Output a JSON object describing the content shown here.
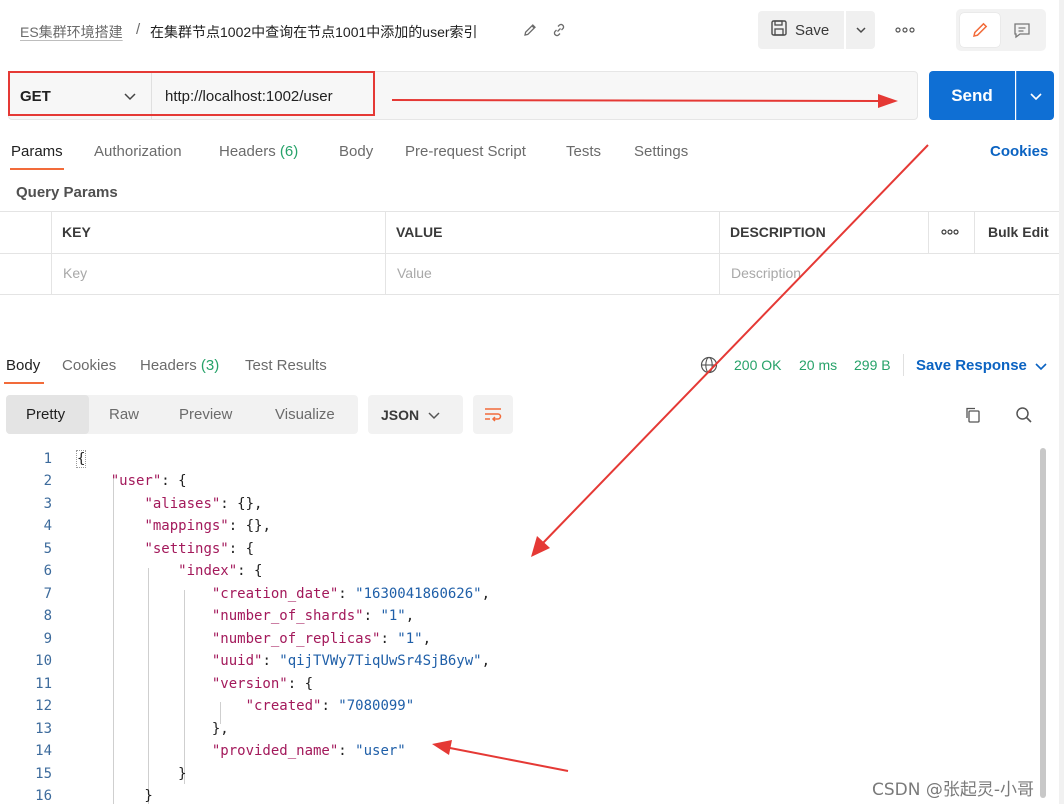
{
  "header": {
    "breadcrumb_parent": "ES集群环境搭建",
    "breadcrumb_separator": "/",
    "request_name": "在集群节点1002中查询在节点1001中添加的user索引",
    "save_label": "Save"
  },
  "request": {
    "method": "GET",
    "url": "http://localhost:1002/user",
    "send_label": "Send"
  },
  "request_tabs": {
    "params": "Params",
    "authorization": "Authorization",
    "headers": "Headers",
    "headers_count": "(6)",
    "body": "Body",
    "pre_request": "Pre-request Script",
    "tests": "Tests",
    "settings": "Settings",
    "cookies": "Cookies"
  },
  "query_params": {
    "label": "Query Params",
    "columns": {
      "key": "KEY",
      "value": "VALUE",
      "description": "DESCRIPTION",
      "bulk_edit": "Bulk Edit"
    },
    "placeholders": {
      "key": "Key",
      "value": "Value",
      "description": "Description"
    }
  },
  "response_tabs": {
    "body": "Body",
    "cookies": "Cookies",
    "headers": "Headers",
    "headers_count": "(3)",
    "test_results": "Test Results"
  },
  "response_status": {
    "status": "200 OK",
    "time": "20 ms",
    "size": "299 B",
    "save_response": "Save Response"
  },
  "view_modes": {
    "pretty": "Pretty",
    "raw": "Raw",
    "preview": "Preview",
    "visualize": "Visualize",
    "format": "JSON"
  },
  "code_lines": [
    "1",
    "2",
    "3",
    "4",
    "5",
    "6",
    "7",
    "8",
    "9",
    "10",
    "11",
    "12",
    "13",
    "14",
    "15",
    "16"
  ],
  "json": {
    "root_key": "\"user\"",
    "aliases_key": "\"aliases\"",
    "mappings_key": "\"mappings\"",
    "settings_key": "\"settings\"",
    "index_key": "\"index\"",
    "creation_date_key": "\"creation_date\"",
    "creation_date_val": "\"1630041860626\"",
    "shards_key": "\"number_of_shards\"",
    "shards_val": "\"1\"",
    "replicas_key": "\"number_of_replicas\"",
    "replicas_val": "\"1\"",
    "uuid_key": "\"uuid\"",
    "uuid_val": "\"qijTVWy7TiqUwSr4SjB6yw\"",
    "version_key": "\"version\"",
    "created_key": "\"created\"",
    "created_val": "\"7080099\"",
    "provided_name_key": "\"provided_name\"",
    "provided_name_val": "\"user\""
  },
  "watermark": "CSDN @张起灵-小哥",
  "colors": {
    "accent_orange": "#f26b3a",
    "send_blue": "#0f6fd4",
    "link_blue": "#0b63c2",
    "status_green": "#26a269",
    "annotation_red": "#e53935",
    "json_key": "#a3195b",
    "json_string": "#1f5fa8"
  }
}
